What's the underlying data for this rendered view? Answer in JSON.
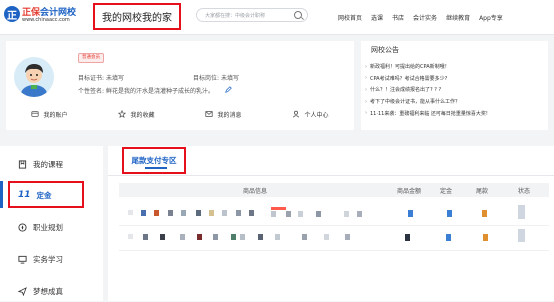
{
  "header": {
    "logo_mark": "正",
    "brand": "正保",
    "brand_sub": "会计网校",
    "url": "www.chinaacc.com",
    "page_title": "我的网校我的家",
    "search_placeholder": "大家都在搜：中级会计职称",
    "nav": [
      "网校首页",
      "选课",
      "书店",
      "会计实务",
      "继续教育",
      "App专享"
    ]
  },
  "profile": {
    "badge": "普通会员",
    "cert_label": "目标证书:",
    "cert_value": "未填写",
    "position_label": "目标岗位:",
    "position_value": "未填写",
    "signature_label": "个性签名:",
    "signature_value": "鲜花是我的汗水是浇灌种子成长的乳汁。",
    "quick_links": [
      "我的账户",
      "我的收藏",
      "我的消息",
      "个人中心"
    ]
  },
  "notices": {
    "title": "网校公告",
    "items": [
      "新政福利！可提出给的CPA新制哦！",
      "CPA考试难吗？考试合格需要多少?",
      "什么？！注会成绩报名出了? ? ?",
      "考下了中级会计证书，能从事什么工作？",
      "11·11来袭：重磅福利来临 还可每日抢重量惊喜大奖!"
    ]
  },
  "sidebar": {
    "items": [
      "我的课程",
      "定金",
      "职业规划",
      "实务学习",
      "梦想成真"
    ]
  },
  "main": {
    "tab": "尾款支付专区",
    "columns": [
      "商品信息",
      "商品金额",
      "定金",
      "尾款",
      "状态"
    ]
  },
  "colors": {
    "brand_blue": "#1e63c4",
    "highlight_red": "#e5101b",
    "accent_red": "#e33b2f"
  }
}
